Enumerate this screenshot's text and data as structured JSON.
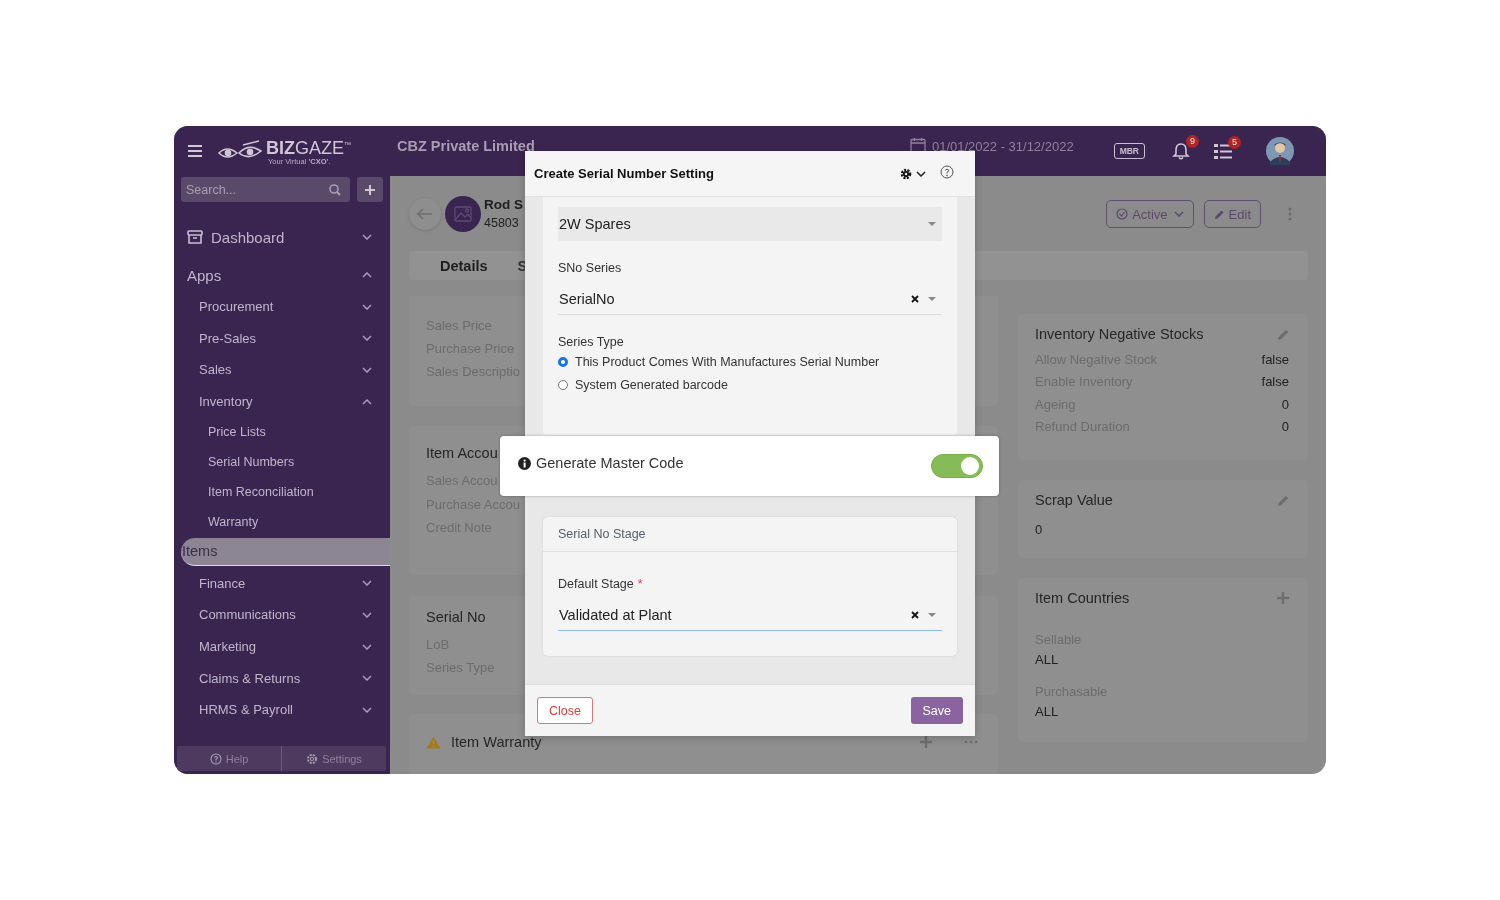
{
  "header": {
    "logo": "**BIZ**GAZE$^{™}$",
    "tagline": "Your Virtual **'CXO'**.",
    "company": "CBZ Private Limited",
    "date_range": "01/01/2022 - 31/12/2022",
    "badge": "MBR",
    "notifications": "9",
    "tasks": "5"
  },
  "sidebar": {
    "search": {
      "placeholder": "Search..."
    },
    "items": [
      {
        "label": "Dashboard",
        "kind": "top",
        "expanded": false
      },
      {
        "label": "Apps",
        "kind": "section",
        "expanded": true,
        "children": [
          {
            "label": "Procurement",
            "expanded": false
          },
          {
            "label": "Pre-Sales",
            "expanded": false
          },
          {
            "label": "Sales",
            "expanded": false
          },
          {
            "label": "Inventory",
            "expanded": true,
            "children": [
              {
                "label": "Price Lists",
                "selected": false
              },
              {
                "label": "Serial Numbers",
                "selected": false
              },
              {
                "label": "Item Reconciliation",
                "selected": false
              },
              {
                "label": "Warranty",
                "selected": false
              },
              {
                "label": "Items",
                "selected": true
              }
            ]
          },
          {
            "label": "Finance",
            "expanded": false
          },
          {
            "label": "Communications",
            "expanded": false
          },
          {
            "label": "Marketing",
            "expanded": false
          },
          {
            "label": "Claims & Returns",
            "expanded": false
          },
          {
            "label": "HRMS & Payroll",
            "expanded": false
          }
        ]
      }
    ],
    "footer": [
      {
        "label": "Help",
        "kind": "help"
      },
      {
        "label": "Settings",
        "kind": "settings"
      }
    ]
  },
  "record": {
    "name": "Rod S",
    "code": "45803",
    "status": "Active",
    "edit": "Edit"
  },
  "tabs": [
    {
      "label": "Details",
      "selected": true
    },
    {
      "label": "S",
      "selected": false
    }
  ],
  "middle_cards": [
    {
      "kind": "rows",
      "rows": [
        {
          "label": "Sales Price"
        },
        {
          "label": "Purchase Price"
        },
        {
          "label": "Sales Descriptio"
        }
      ]
    },
    {
      "kind": "rows",
      "title": "Item Accou",
      "rows": [
        {
          "label": "Sales Accou"
        },
        {
          "label": "Purchase Accou"
        },
        {
          "label": "Credit Note"
        }
      ]
    },
    {
      "kind": "rows",
      "title": "Serial No",
      "rows": [
        {
          "label": "LoB"
        },
        {
          "label": "Series Type"
        }
      ]
    },
    {
      "kind": "warning",
      "title": "Item Warranty"
    }
  ],
  "right_cards": [
    {
      "title": "Inventory Negative Stocks",
      "kind": "pairs",
      "rows": [
        {
          "label": "Allow Negative Stock",
          "value": "false"
        },
        {
          "label": "Enable Inventory",
          "value": "false"
        },
        {
          "label": "Ageing",
          "value": "0"
        },
        {
          "label": "Refund Duration",
          "value": "0"
        }
      ]
    },
    {
      "title": "Scrap Value",
      "kind": "plain",
      "text": "0"
    },
    {
      "title": "Item Countries",
      "kind": "stacked",
      "rows": [
        {
          "label": "Sellable",
          "value": "ALL"
        },
        {
          "label": "Purchasable",
          "value": "ALL"
        }
      ]
    }
  ],
  "modal": {
    "title": "Create Serial Number Setting",
    "fields": [
      {
        "kind": "select",
        "value": "2W Spares",
        "disabled": true
      },
      {
        "kind": "select",
        "label": "SNo Series",
        "value": "SerialNo",
        "clearable": true,
        "disabled": false
      },
      {
        "kind": "radio",
        "label": "Series Type",
        "options": [
          {
            "label": "This Product Comes With Manufactures Serial Number",
            "selected": true
          },
          {
            "label": "System Generated barcode",
            "selected": false
          }
        ]
      }
    ],
    "section": {
      "title": "Serial No Stage",
      "fields": [
        {
          "kind": "select",
          "label": "Default Stage",
          "required_mark": "*",
          "value": "Validated at Plant",
          "clearable": true,
          "focused": true,
          "disabled": false
        }
      ]
    },
    "buttons": [
      {
        "label": "Close",
        "kind": "secondary"
      },
      {
        "label": "Save",
        "kind": "primary"
      }
    ]
  },
  "popup": {
    "label": "Generate Master Code",
    "on": true
  }
}
